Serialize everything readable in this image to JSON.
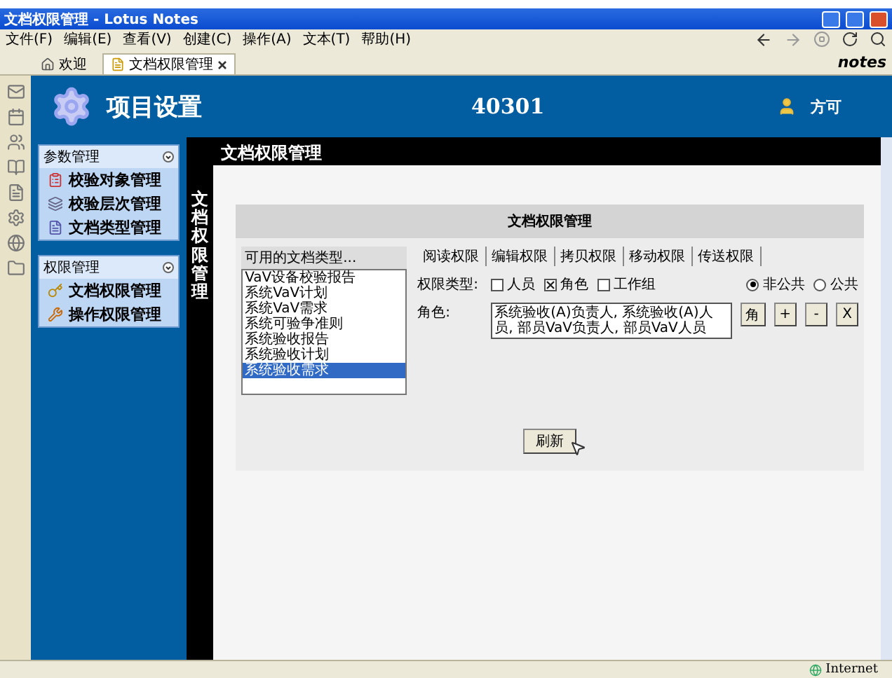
{
  "window": {
    "title": "文档权限管理 - Lotus Notes"
  },
  "menu": [
    {
      "label": "文件(F)"
    },
    {
      "label": "编辑(E)"
    },
    {
      "label": "查看(V)"
    },
    {
      "label": "创建(C)"
    },
    {
      "label": "操作(A)"
    },
    {
      "label": "文本(T)"
    },
    {
      "label": "帮助(H)"
    }
  ],
  "doc_tabs": [
    {
      "label": "欢迎",
      "selected": false
    },
    {
      "label": "文档权限管理",
      "selected": true
    }
  ],
  "brand": "notes",
  "header": {
    "title": "项目设置",
    "code": "40301",
    "user": "方可"
  },
  "sidebar": {
    "sections": [
      {
        "title": "参数管理",
        "items": [
          {
            "label": "校验对象管理"
          },
          {
            "label": "校验层次管理"
          },
          {
            "label": "文档类型管理"
          }
        ]
      },
      {
        "title": "权限管理",
        "items": [
          {
            "label": "文档权限管理"
          },
          {
            "label": "操作权限管理"
          }
        ]
      }
    ]
  },
  "page_title": "文档权限管理",
  "vertical_title": "文档权限管理",
  "panel": {
    "title": "文档权限管理",
    "list_label": "可用的文档类型...",
    "list_items": [
      {
        "label": "VaV设备校验报告",
        "selected": false
      },
      {
        "label": "系统VaV计划",
        "selected": false
      },
      {
        "label": "系统VaV需求",
        "selected": false
      },
      {
        "label": "系统可验争准则",
        "selected": false
      },
      {
        "label": "系统验收报告",
        "selected": false
      },
      {
        "label": "系统验收计划",
        "selected": false
      },
      {
        "label": "系统验收需求",
        "selected": true
      }
    ],
    "tabs": [
      {
        "label": "阅读权限"
      },
      {
        "label": "编辑权限"
      },
      {
        "label": "拷贝权限"
      },
      {
        "label": "移动权限"
      },
      {
        "label": "传送权限"
      }
    ],
    "type_label": "权限类型:",
    "checkboxes": [
      {
        "label": "人员",
        "checked": false
      },
      {
        "label": "角色",
        "checked": true
      },
      {
        "label": "工作组",
        "checked": false
      }
    ],
    "radios": [
      {
        "label": "非公共",
        "selected": true
      },
      {
        "label": "公共",
        "selected": false
      }
    ],
    "role_label": "角色:",
    "role_value": "系统验收(A)负责人, 系统验收(A)人员, 部员VaV负责人, 部员VaV人员",
    "buttons": [
      {
        "label": "角"
      },
      {
        "label": "+"
      },
      {
        "label": "-"
      },
      {
        "label": "X"
      }
    ],
    "refresh": "刷新"
  },
  "status_bar": {
    "zone": "Internet"
  }
}
